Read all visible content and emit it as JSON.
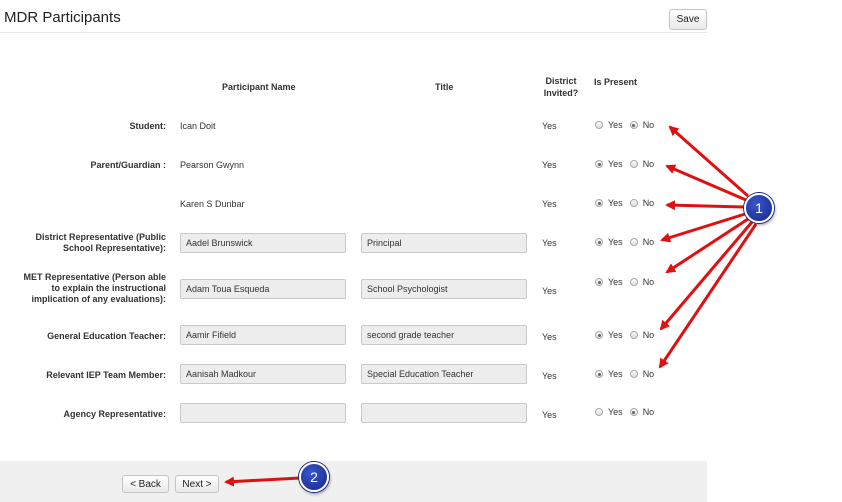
{
  "page": {
    "title": "MDR Participants",
    "save_label": "Save"
  },
  "headers": {
    "participant_name": "Participant Name",
    "title": "Title",
    "district_line1": "District",
    "district_line2": "Invited?",
    "is_present": "Is Present"
  },
  "radio_labels": {
    "yes": "Yes",
    "no": "No"
  },
  "rows": [
    {
      "label": [],
      "name": "Ican Doit",
      "title": "",
      "district": "Yes",
      "present": "No"
    },
    {
      "label": [],
      "name": "Pearson Gwynn",
      "title": "",
      "district": "Yes",
      "present": "Yes"
    },
    {
      "label": [],
      "name": "Karen S Dunbar",
      "title": "",
      "district": "Yes",
      "present": "Yes"
    },
    {
      "label": [
        "District Representative (Public",
        "School Representative):"
      ],
      "name": "Aadel Brunswick",
      "title": "Principal",
      "district": "Yes",
      "present": "Yes"
    },
    {
      "label": [
        "MET Representative (Person able",
        "to explain the instructional",
        "implication of any evaluations):"
      ],
      "name": "Adam Toua Esqueda",
      "title": "School Psychologist",
      "district": "Yes",
      "present": "Yes"
    },
    {
      "label": [
        "General Education Teacher:"
      ],
      "name": "Aamir Fifield",
      "title": "second grade teacher",
      "district": "Yes",
      "present": "Yes"
    },
    {
      "label": [
        "Relevant IEP Team Member:"
      ],
      "name": "Aanisah Madkour",
      "title": "Special Education Teacher",
      "district": "Yes",
      "present": "Yes"
    },
    {
      "label": [
        "Agency Representative:"
      ],
      "name": "",
      "title": "",
      "district": "Yes",
      "present": "No"
    }
  ],
  "row_labels": {
    "student": "Student:",
    "parent": "Parent/Guardian :",
    "district_rep_1": "District Representative (Public",
    "district_rep_2": "School Representative):",
    "met_rep_1": "MET Representative (Person able",
    "met_rep_2": "to explain the instructional",
    "met_rep_3": "implication of any evaluations):",
    "gen_ed": "General Education Teacher:",
    "iep": "Relevant IEP Team Member:",
    "agency": "Agency Representative:"
  },
  "footer": {
    "back_label": "< Back",
    "next_label": "Next >"
  },
  "callouts": {
    "one": "1",
    "two": "2"
  },
  "colors": {
    "arrow": "#e01010",
    "callout": "#1f34a8"
  }
}
